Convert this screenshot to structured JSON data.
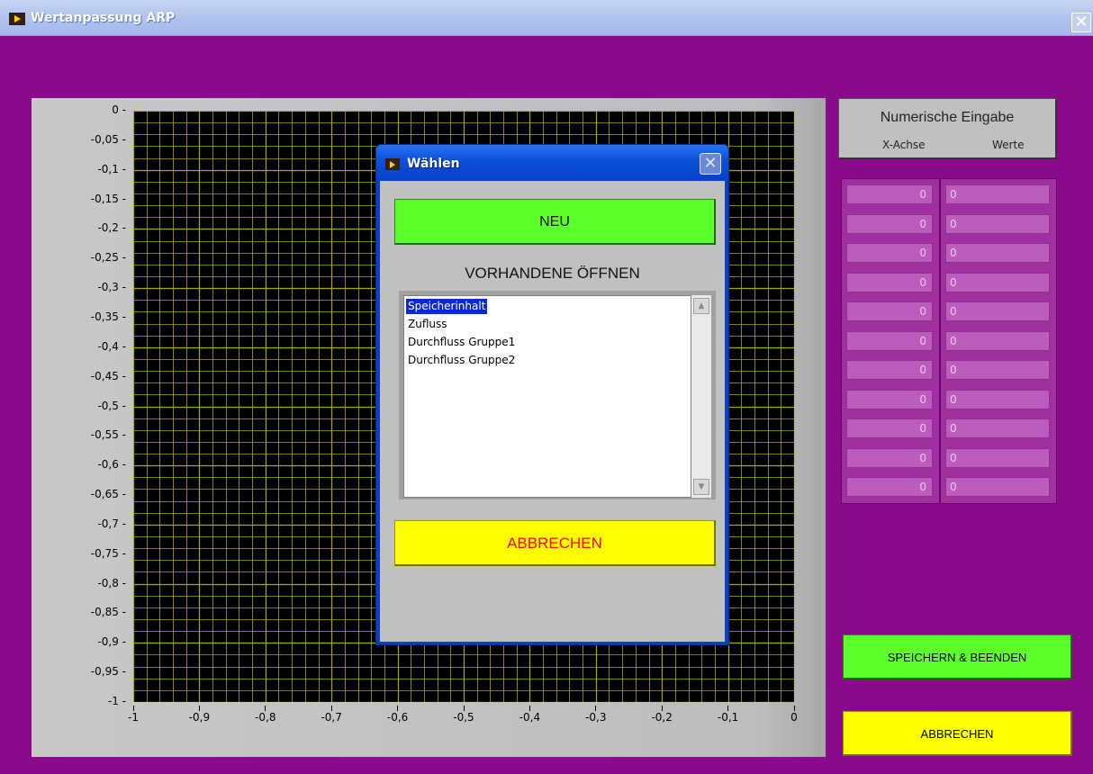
{
  "window": {
    "title": "Wertanpassung ARP",
    "close_symbol": "✕"
  },
  "graph": {
    "y_ticks": [
      "0",
      "-0,05",
      "-0,1",
      "-0,15",
      "-0,2",
      "-0,25",
      "-0,3",
      "-0,35",
      "-0,4",
      "-0,45",
      "-0,5",
      "-0,55",
      "-0,6",
      "-0,65",
      "-0,7",
      "-0,75",
      "-0,8",
      "-0,85",
      "-0,9",
      "-0,95",
      "-1"
    ],
    "x_ticks": [
      "-1",
      "-0,9",
      "-0,8",
      "-0,7",
      "-0,6",
      "-0,5",
      "-0,4",
      "-0,3",
      "-0,2",
      "-0,1",
      "0"
    ],
    "grid_color": "#a8a800",
    "background_color": "#000000"
  },
  "numeric_input": {
    "title": "Numerische Eingabe",
    "x_axis_label": "X-Achse",
    "values_label": "Werte",
    "x_values": [
      "0",
      "0",
      "0",
      "0",
      "0",
      "0",
      "0",
      "0",
      "0",
      "0",
      "0"
    ],
    "y_values": [
      "0",
      "0",
      "0",
      "0",
      "0",
      "0",
      "0",
      "0",
      "0",
      "0",
      "0"
    ]
  },
  "buttons": {
    "save_and_exit": "SPEICHERN & BEENDEN",
    "cancel": "ABBRECHEN"
  },
  "dialog": {
    "title": "Wählen",
    "close_symbol": "✕",
    "new_button": "NEU",
    "open_existing_label": "VORHANDENE ÖFFNEN",
    "list_items": [
      "Speicherinhalt",
      "Zufluss",
      "Durchfluss Gruppe1",
      "Durchfluss Gruppe2"
    ],
    "selected_index": 0,
    "cancel_button": "ABBRECHEN"
  }
}
